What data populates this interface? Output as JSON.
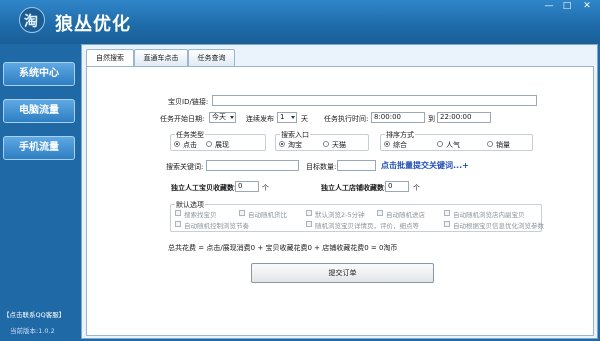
{
  "app": {
    "title": "狼丛优化",
    "logo_char": "淘"
  },
  "window": {
    "min": "—",
    "max": "□",
    "close": "✕"
  },
  "sidebar": {
    "items": [
      {
        "label": "系统中心"
      },
      {
        "label": "电脑流量"
      },
      {
        "label": "手机流量"
      }
    ],
    "support": "【点击联系QQ客服】",
    "version": "当前版本:1.0.2"
  },
  "tabs": [
    {
      "label": "自然搜索"
    },
    {
      "label": "直通车点击"
    },
    {
      "label": "任务查询"
    }
  ],
  "form": {
    "product_id_label": "宝贝ID/链接:",
    "product_id_value": "",
    "start_date_label": "任务开始日期:",
    "start_date_value": "今天",
    "consecutive_label": "连续发布",
    "consecutive_value": "1",
    "days_label": "天",
    "exec_time_label": "任务执行时间:",
    "time_start": "8:00:00",
    "to_label": "到",
    "time_end": "22:00:00",
    "task_type": {
      "title": "任务类型",
      "options": [
        "点击",
        "展现"
      ],
      "selected": "点击"
    },
    "search_entry": {
      "title": "搜索入口",
      "options": [
        "淘宝",
        "天猫"
      ],
      "selected": "淘宝"
    },
    "sort_method": {
      "title": "排序方式",
      "options": [
        "综合",
        "人气",
        "销量"
      ],
      "selected": "综合"
    },
    "keyword_label": "搜索关键词:",
    "keyword_value": "",
    "target_count_label": "目标数量:",
    "target_count_value": "",
    "batch_link": "点击批量提交关键词...+",
    "fav_product_label": "独立人工宝贝收藏数:",
    "fav_product_value": "0",
    "fav_product_unit": "个",
    "fav_shop_label": "独立人工店铺收藏数:",
    "fav_shop_value": "0",
    "fav_shop_unit": "个",
    "default_options": {
      "title": "默认选项",
      "items": [
        "搜索找宝贝",
        "自动随机货比",
        "默认浏览2-5分钟",
        "自动随机进店",
        "自动随机浏览店内副宝贝",
        "自动随机控制浏览节奏",
        "随机浏览宝贝详情页，评价，细点等",
        "自动根据宝贝信息优化浏览参数"
      ]
    },
    "total_cost": "总共花费 = 点击/展现消费0 + 宝贝收藏花费0 + 店铺收藏花费0 = 0淘币",
    "submit_label": "提交订单"
  },
  "colors": {
    "titlebar": "#2f86c9",
    "sidebar_bg": "#1f6aa6",
    "panel_bg": "#eaf3fb",
    "link": "#1f4fb4"
  }
}
